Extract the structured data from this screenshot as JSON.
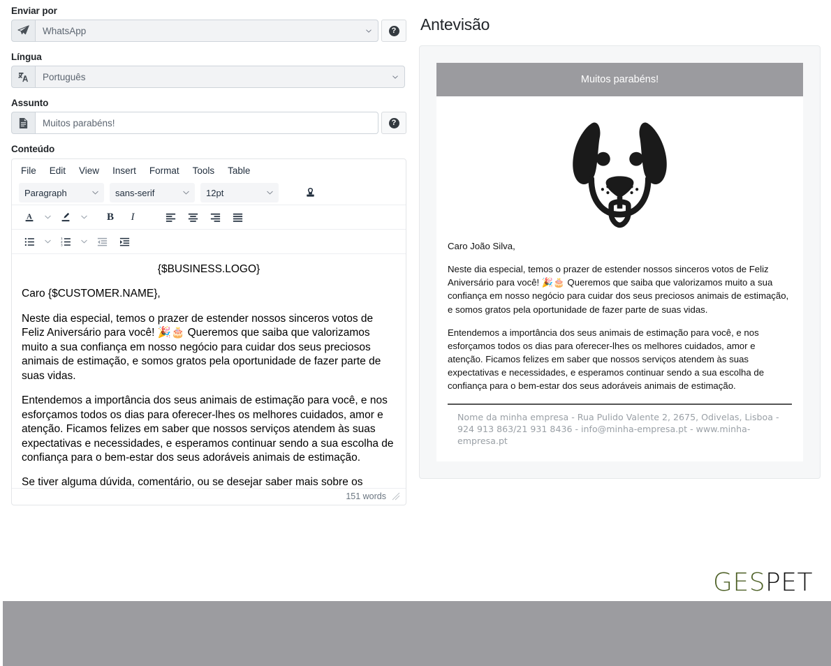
{
  "form": {
    "send_by": {
      "label": "Enviar por",
      "icon": "paper-plane-icon",
      "value": "WhatsApp",
      "help": "?"
    },
    "language": {
      "label": "Língua",
      "icon": "translate-icon",
      "value": "Português"
    },
    "subject": {
      "label": "Assunto",
      "icon": "document-icon",
      "value": "Muitos parabéns!",
      "help": "?"
    },
    "content": {
      "label": "Conteúdo"
    }
  },
  "editor": {
    "menubar": [
      "File",
      "Edit",
      "View",
      "Insert",
      "Format",
      "Tools",
      "Table"
    ],
    "toolbar": {
      "block_format": "Paragraph",
      "font_family": "sans-serif",
      "font_size": "12pt",
      "stamp_icon": "stamp-icon",
      "text_color_icon": "text-color-icon",
      "highlight_icon": "highlight-color-icon",
      "bold": "B",
      "italic": "I",
      "align_left_icon": "align-left-icon",
      "align_center_icon": "align-center-icon",
      "align_right_icon": "align-right-icon",
      "align_justify_icon": "align-justify-icon",
      "bullet_list_icon": "bullet-list-icon",
      "numbered_list_icon": "numbered-list-icon",
      "outdent_icon": "outdent-icon",
      "indent_icon": "indent-icon"
    },
    "content": {
      "logo_token": "{$BUSINESS.LOGO}",
      "greeting": "Caro {$CUSTOMER.NAME},",
      "p1": "Neste dia especial, temos o prazer de estender nossos sinceros votos de Feliz Aniversário para você! 🎉🎂 Queremos que saiba que valorizamos muito a sua confiança em nosso negócio para cuidar dos seus preciosos animais de estimação, e somos gratos pela oportunidade de fazer parte de suas vidas.",
      "p2": "Entendemos a importância dos seus animais de estimação para você, e nos esforçamos todos os dias para oferecer-lhes os melhores cuidados, amor e atenção. Ficamos felizes em saber que nossos serviços atendem às suas expectativas e necessidades, e esperamos continuar sendo a sua escolha de confiança para o bem-estar dos seus adoráveis animais de estimação.",
      "p3": "Se tiver alguma dúvida, comentário, ou se desejar saber mais sobre os"
    },
    "status": {
      "word_count": "151 words",
      "resize_icon": "resize-grip-icon"
    }
  },
  "preview": {
    "title": "Antevisão",
    "mail": {
      "header": "Muitos parabéns!",
      "logo_icon": "dog-face-logo",
      "greeting": "Caro João Silva,",
      "p1": "Neste dia especial, temos o prazer de estender nossos sinceros votos de Feliz Aniversário para você! 🎉🎂 Queremos que saiba que valorizamos muito a sua confiança em nosso negócio para cuidar dos seus preciosos animais de estimação, e somos gratos pela oportunidade de fazer parte de suas vidas.",
      "p2": "Entendemos a importância dos seus animais de estimação para você, e nos esforçamos todos os dias para oferecer-lhes os melhores cuidados, amor e atenção. Ficamos felizes em saber que nossos serviços atendem às suas expectativas e necessidades, e esperamos continuar sendo a sua escolha de confiança para o bem-estar dos seus adoráveis animais de estimação.",
      "footer": "Nome da minha empresa - Rua Pulido Valente 2, 2675, Odivelas, Lisboa - 924 913 863/21 931 8436 - info@minha-empresa.pt - www.minha-empresa.pt"
    }
  },
  "brand": {
    "part1": "GES",
    "part2": "PET"
  },
  "colors": {
    "brand_green": "#4f6228",
    "brand_black": "#111111",
    "mail_header_bg": "#9b9b9f",
    "bottom_bar_bg": "#9c9ca0",
    "addon_bg": "#e9ecef",
    "border": "#ced4da"
  }
}
